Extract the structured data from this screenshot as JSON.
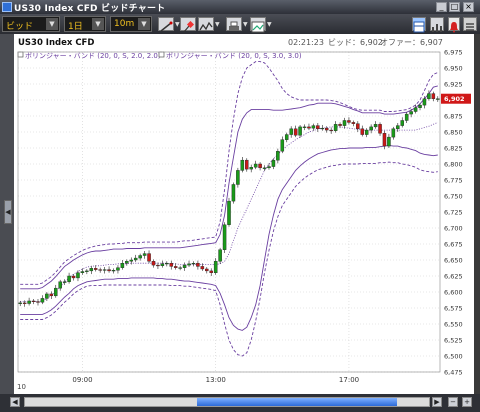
{
  "window": {
    "title": "US30 Index CFD ビッドチャート"
  },
  "toolbar": {
    "price_type": "ビッド",
    "period": "1日",
    "interval": "10m",
    "tool_icons": [
      "draw-line-icon",
      "pin-icon",
      "indicator-icon",
      "print-icon",
      "image-export-icon"
    ],
    "right_icons": [
      "layout-icon",
      "bar-chart-icon",
      "alarm-icon",
      "menu-icon"
    ]
  },
  "chart": {
    "symbol_label": "US30 Index CFD",
    "status": {
      "time": "02:21:23",
      "bid_label": "ビッド：6,902",
      "offer_label": "オファー：6,907"
    },
    "indicators": [
      "ボリンジャー・バンド (20, 0, S, 2.0, 2.0)",
      "ボリンジャー・バンド (20, 0, S, 3.0, 3.0)"
    ],
    "x_ticks": [
      "09:00",
      "13:00",
      "17:00"
    ],
    "bottom_left_label": "10",
    "current_price": "6,902",
    "colors": {
      "up": "#1a9a1a",
      "down": "#c81818",
      "band": "#6a3fa0",
      "price_tag": "#d01818"
    }
  },
  "chart_data": {
    "type": "candlestick",
    "ylim": [
      6475,
      6975
    ],
    "y_ticks": [
      6475,
      6500,
      6525,
      6550,
      6575,
      6600,
      6625,
      6650,
      6675,
      6700,
      6725,
      6750,
      6775,
      6800,
      6825,
      6850,
      6875,
      6900,
      6925,
      6950,
      6975
    ],
    "x_tick_positions": {
      "09:00": 14,
      "13:00": 44,
      "17:00": 74
    },
    "series": [
      {
        "name": "price",
        "values": [
          6583,
          6582,
          6586,
          6585,
          6584,
          6590,
          6597,
          6594,
          6606,
          6616,
          6616,
          6625,
          6622,
          6630,
          6632,
          6633,
          6637,
          6635,
          6634,
          6635,
          6633,
          6634,
          6638,
          6645,
          6648,
          6650,
          6653,
          6657,
          6660,
          6648,
          6642,
          6641,
          6644,
          6645,
          6640,
          6638,
          6638,
          6642,
          6644,
          6645,
          6640,
          6636,
          6633,
          6630,
          6648,
          6666,
          6705,
          6742,
          6768,
          6790,
          6806,
          6792,
          6795,
          6800,
          6794,
          6794,
          6796,
          6806,
          6820,
          6838,
          6846,
          6855,
          6845,
          6858,
          6858,
          6856,
          6860,
          6855,
          6856,
          6853,
          6852,
          6862,
          6860,
          6868,
          6865,
          6863,
          6855,
          6846,
          6853,
          6858,
          6862,
          6848,
          6828,
          6842,
          6855,
          6860,
          6868,
          6878,
          6882,
          6888,
          6892,
          6902,
          6910,
          6902,
          6902
        ]
      },
      {
        "name": "ボリンジャー・バンド (20, 0, S, 2.0, 2.0) upper",
        "values": [
          6605,
          6605,
          6605,
          6605,
          6605,
          6607,
          6612,
          6617,
          6624,
          6632,
          6640,
          6645,
          6650,
          6654,
          6658,
          6661,
          6663,
          6664,
          6664,
          6665,
          6666,
          6667,
          6667,
          6667,
          6668,
          6668,
          6668,
          6668,
          6669,
          6669,
          6669,
          6669,
          6669,
          6669,
          6669,
          6669,
          6669,
          6670,
          6671,
          6672,
          6673,
          6674,
          6675,
          6676,
          6677,
          6690,
          6720,
          6770,
          6810,
          6850,
          6870,
          6880,
          6885,
          6885,
          6885,
          6885,
          6885,
          6884,
          6884,
          6884,
          6885,
          6886,
          6887,
          6888,
          6890,
          6892,
          6893,
          6895,
          6895,
          6895,
          6895,
          6894,
          6892,
          6890,
          6888,
          6885,
          6883,
          6880,
          6880,
          6880,
          6880,
          6880,
          6878,
          6878,
          6878,
          6879,
          6880,
          6881,
          6884,
          6888,
          6894,
          6902,
          6910,
          6920,
          6922
        ]
      },
      {
        "name": "ボリンジャー・バンド (20, 0, S, 2.0, 2.0) lower",
        "values": [
          6565,
          6565,
          6565,
          6565,
          6565,
          6565,
          6568,
          6572,
          6578,
          6585,
          6592,
          6598,
          6605,
          6610,
          6613,
          6616,
          6617,
          6618,
          6619,
          6620,
          6620,
          6620,
          6621,
          6621,
          6621,
          6622,
          6622,
          6622,
          6622,
          6622,
          6622,
          6621,
          6621,
          6620,
          6620,
          6619,
          6618,
          6617,
          6617,
          6616,
          6615,
          6614,
          6613,
          6612,
          6610,
          6598,
          6580,
          6560,
          6548,
          6542,
          6540,
          6545,
          6560,
          6580,
          6610,
          6650,
          6690,
          6720,
          6745,
          6760,
          6770,
          6780,
          6790,
          6797,
          6803,
          6808,
          6812,
          6816,
          6818,
          6820,
          6822,
          6823,
          6824,
          6824,
          6825,
          6825,
          6825,
          6825,
          6826,
          6826,
          6826,
          6827,
          6828,
          6829,
          6828,
          6828,
          6826,
          6825,
          6823,
          6821,
          6817,
          6815,
          6814,
          6813,
          6814
        ]
      },
      {
        "name": "ボリンジャー・バンド (20, 0, S, 3.0, 3.0) upper",
        "values": [
          6612,
          6612,
          6612,
          6612,
          6612,
          6614,
          6619,
          6624,
          6631,
          6639,
          6647,
          6652,
          6657,
          6661,
          6665,
          6668,
          6670,
          6672,
          6673,
          6674,
          6675,
          6675,
          6676,
          6676,
          6677,
          6677,
          6677,
          6677,
          6678,
          6678,
          6678,
          6678,
          6678,
          6678,
          6678,
          6678,
          6679,
          6680,
          6680,
          6681,
          6682,
          6683,
          6684,
          6685,
          6686,
          6710,
          6760,
          6820,
          6870,
          6910,
          6935,
          6950,
          6955,
          6960,
          6960,
          6958,
          6950,
          6940,
          6930,
          6918,
          6910,
          6905,
          6902,
          6900,
          6900,
          6900,
          6900,
          6900,
          6900,
          6900,
          6899,
          6898,
          6896,
          6893,
          6890,
          6887,
          6885,
          6884,
          6884,
          6884,
          6884,
          6884,
          6882,
          6882,
          6882,
          6883,
          6884,
          6885,
          6888,
          6892,
          6900,
          6915,
          6930,
          6940,
          6943
        ]
      },
      {
        "name": "ボリンジャー・バンド (20, 0, S, 3.0, 3.0) lower",
        "values": [
          6557,
          6557,
          6557,
          6557,
          6557,
          6557,
          6560,
          6564,
          6570,
          6577,
          6584,
          6590,
          6597,
          6602,
          6606,
          6609,
          6610,
          6610,
          6610,
          6611,
          6611,
          6611,
          6611,
          6611,
          6611,
          6611,
          6611,
          6611,
          6611,
          6611,
          6611,
          6611,
          6611,
          6611,
          6610,
          6610,
          6610,
          6609,
          6609,
          6608,
          6607,
          6606,
          6605,
          6604,
          6602,
          6580,
          6550,
          6525,
          6510,
          6502,
          6500,
          6505,
          6525,
          6555,
          6590,
          6630,
          6665,
          6695,
          6718,
          6735,
          6745,
          6755,
          6765,
          6772,
          6778,
          6783,
          6787,
          6791,
          6793,
          6795,
          6797,
          6798,
          6799,
          6800,
          6800,
          6800,
          6800,
          6801,
          6801,
          6801,
          6801,
          6802,
          6802,
          6803,
          6802,
          6802,
          6800,
          6799,
          6797,
          6795,
          6791,
          6789,
          6788,
          6787,
          6788
        ]
      },
      {
        "name": "middle",
        "values": [
          6585,
          6585,
          6585,
          6585,
          6585,
          6586,
          6590,
          6594,
          6601,
          6608,
          6616,
          6622,
          6628,
          6632,
          6636,
          6639,
          6640,
          6641,
          6641,
          6642,
          6643,
          6643,
          6644,
          6644,
          6644,
          6645,
          6645,
          6645,
          6645,
          6645,
          6645,
          6645,
          6645,
          6645,
          6644,
          6644,
          6643,
          6643,
          6643,
          6643,
          6643,
          6643,
          6643,
          6643,
          6643,
          6644,
          6648,
          6660,
          6680,
          6700,
          6715,
          6730,
          6745,
          6760,
          6775,
          6790,
          6800,
          6808,
          6815,
          6822,
          6828,
          6833,
          6838,
          6842,
          6846,
          6850,
          6852,
          6855,
          6856,
          6857,
          6858,
          6858,
          6858,
          6857,
          6856,
          6855,
          6854,
          6853,
          6853,
          6853,
          6853,
          6853,
          6853,
          6853,
          6853,
          6853,
          6853,
          6853,
          6853,
          6853,
          6855,
          6857,
          6859,
          6862,
          6865
        ]
      }
    ],
    "current_price": 6902
  }
}
